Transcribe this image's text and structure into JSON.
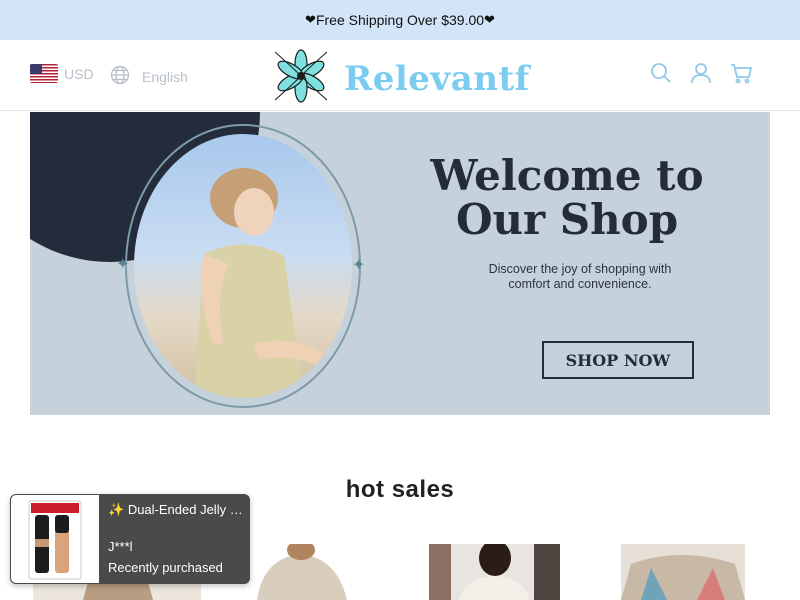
{
  "announcement": {
    "text": "Free Shipping Over $39.00",
    "heart": "❤"
  },
  "header": {
    "currency": "USD",
    "language": "English",
    "logo_text": "Relevantf",
    "icons": [
      "search-icon",
      "account-icon",
      "cart-icon"
    ]
  },
  "banner": {
    "title_line1": "Welcome to",
    "title_line2": "Our Shop",
    "subtitle_line1": "Discover the joy of shopping with",
    "subtitle_line2": "comfort and convenience.",
    "cta": "SHOP NOW"
  },
  "hot_sales": {
    "title": "hot sales"
  },
  "toast": {
    "product_name": "Dual-Ended Jelly …",
    "sparkle": "✨",
    "user": "J***l",
    "status": "Recently purchased"
  },
  "colors": {
    "announce_bg": "#d2e4f8",
    "logo": "#7ccbf0",
    "dark_navy": "#242c3c",
    "banner_bg": "#c6d2db"
  }
}
